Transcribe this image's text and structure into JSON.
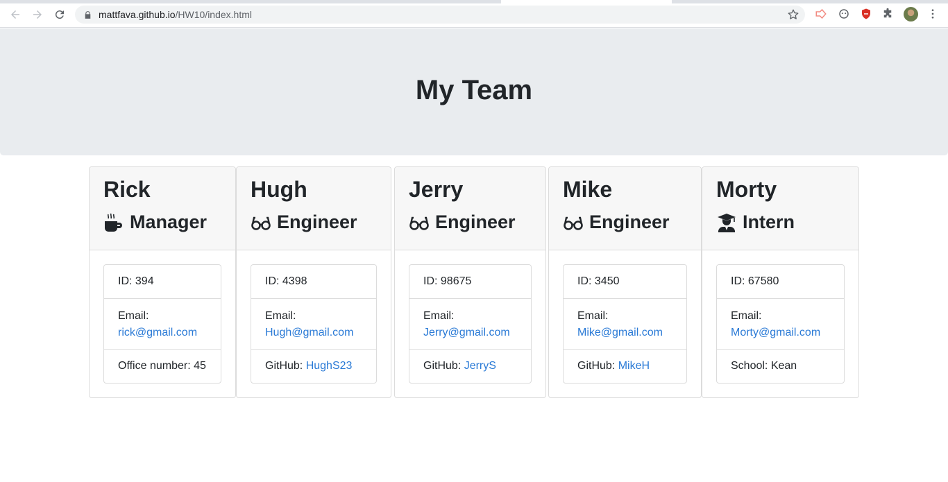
{
  "browser": {
    "url_host": "mattfava.github.io",
    "url_path": "/HW10/index.html"
  },
  "page": {
    "title": "My Team"
  },
  "labels": {
    "email": "Email:",
    "github": "GitHub: ",
    "office": "Office number: ",
    "school": "School: "
  },
  "team": [
    {
      "name": "Rick",
      "role": "Manager",
      "role_icon": "mug-icon",
      "id": "ID: 394",
      "email": "rick@gmail.com",
      "extra_label": "Office number: ",
      "extra_value": "45",
      "extra_is_link": false
    },
    {
      "name": "Hugh",
      "role": "Engineer",
      "role_icon": "glasses-icon",
      "id": "ID: 4398",
      "email": "Hugh@gmail.com",
      "extra_label": "GitHub: ",
      "extra_value": "HughS23",
      "extra_is_link": true
    },
    {
      "name": "Jerry",
      "role": "Engineer",
      "role_icon": "glasses-icon",
      "id": "ID: 98675",
      "email": "Jerry@gmail.com",
      "extra_label": "GitHub: ",
      "extra_value": "JerryS",
      "extra_is_link": true
    },
    {
      "name": "Mike",
      "role": "Engineer",
      "role_icon": "glasses-icon",
      "id": "ID: 3450",
      "email": "Mike@gmail.com",
      "extra_label": "GitHub: ",
      "extra_value": "MikeH",
      "extra_is_link": true
    },
    {
      "name": "Morty",
      "role": "Intern",
      "role_icon": "graduate-icon",
      "id": "ID: 67580",
      "email": "Morty@gmail.com",
      "extra_label": "School: ",
      "extra_value": "Kean",
      "extra_is_link": false
    }
  ],
  "colors": {
    "jumbotron_bg": "#e9ecef",
    "link": "#2a7ad6",
    "card_header_bg": "#f7f7f7"
  }
}
